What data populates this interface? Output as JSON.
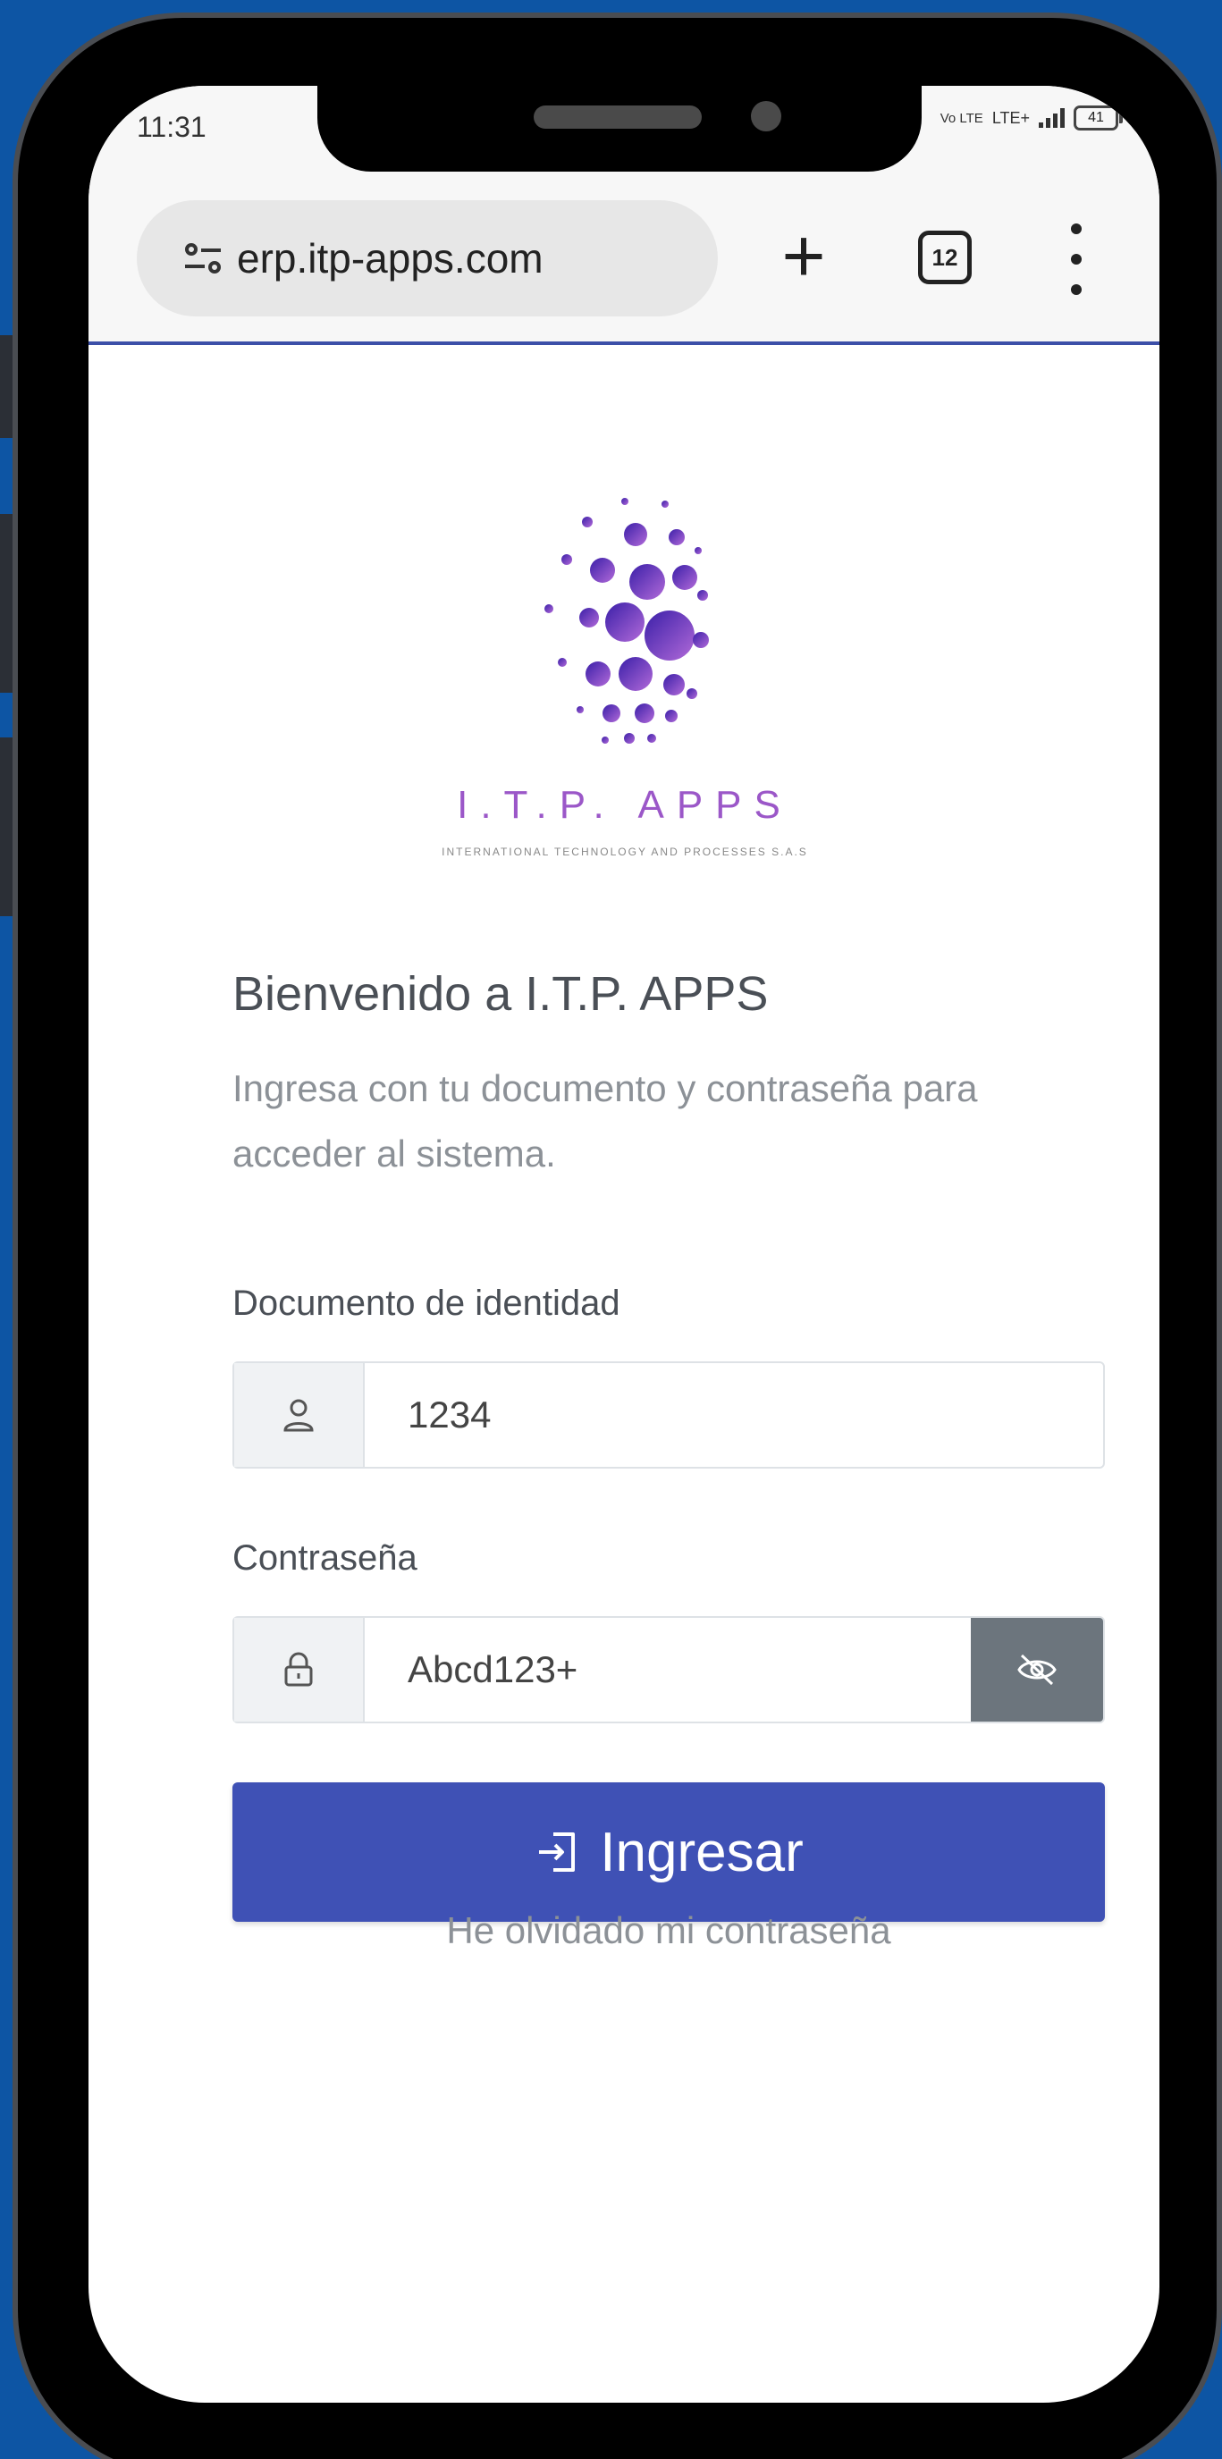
{
  "status_bar": {
    "time": "11:31",
    "network": "LTE+",
    "volte": "Vo LTE",
    "battery": "41"
  },
  "browser": {
    "url": "erp.itp-apps.com",
    "tab_count": "12",
    "new_tab_icon": "plus-icon",
    "menu_icon": "more-vert-icon",
    "site_settings_icon": "tune-icon"
  },
  "logo": {
    "title": "I.T.P. APPS",
    "subtitle": "INTERNATIONAL TECHNOLOGY AND PROCESSES S.A.S"
  },
  "login": {
    "title": "Bienvenido a I.T.P. APPS",
    "subtitle": "Ingresa con tu documento y contraseña para acceder al sistema.",
    "document_label": "Documento de identidad",
    "document_value": "1234",
    "password_label": "Contraseña",
    "password_value": "Abcd123+",
    "submit_label": "Ingresar",
    "forgot_label": "He olvidado mi contraseña"
  },
  "colors": {
    "background": "#0d55a4",
    "primary": "#3f51b5",
    "logo_purple": "#9b57c8",
    "toggle_button": "#6c757d"
  }
}
